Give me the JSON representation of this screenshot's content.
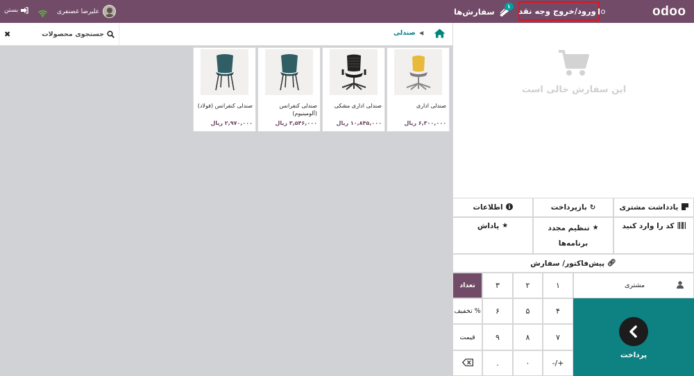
{
  "header": {
    "logo": "odoo",
    "cash_in_out": "ورود/خروج وجه نقد",
    "orders_label": "سفارش‌ها",
    "orders_badge": "۱",
    "user_name": "علیرضا غضنفری",
    "close_label": "بستن"
  },
  "products_bar": {
    "breadcrumb": "صندلی",
    "search_placeholder": "جستجوی محصولات"
  },
  "products": [
    {
      "name": "صندلی اداری",
      "price": "۶,۳۰۰,۰۰۰ ریال",
      "chair_color": "#e8b93a"
    },
    {
      "name": "صندلی اداری مشکی",
      "price": "۱۰,۸۴۵,۰۰۰ ریال",
      "chair_color": "#1e1e1e"
    },
    {
      "name": "صندلی کنفرانس (آلومینیوم)",
      "price": "۳,۵۴۶,۰۰۰ ریال",
      "chair_color": "#2f5f64"
    },
    {
      "name": "صندلی کنفرانس (فولاد)",
      "price": "۲,۹۷۰,۰۰۰ ریال",
      "chair_color": "#2f5f64"
    }
  ],
  "order": {
    "empty_text": "این سفارش خالی است"
  },
  "controls": {
    "customer_note": "یادداشت مشتری",
    "refund": "بازپرداخت",
    "info": "اطلاعات",
    "enter_code": "کد را وارد کنید",
    "reset": "تنظیم مجدد",
    "programs": "برنامه‌ها",
    "reward": "پاداش",
    "quotation": "پیش‌فاکتور/ سفارش"
  },
  "numpad": {
    "customer": "مشتری",
    "pay": "پرداخت",
    "k1": "۱",
    "k2": "۲",
    "k3": "۳",
    "k4": "۴",
    "k5": "۵",
    "k6": "۶",
    "k7": "۷",
    "k8": "۸",
    "k9": "۹",
    "k0": "۰",
    "plusminus": "+/-",
    "dot": ".",
    "qty": "تعداد",
    "disc": "% تخفیف",
    "price": "قیمت"
  },
  "colors": {
    "brand": "#714b67",
    "teal": "#0e8182",
    "highlight": "#e0161d"
  }
}
